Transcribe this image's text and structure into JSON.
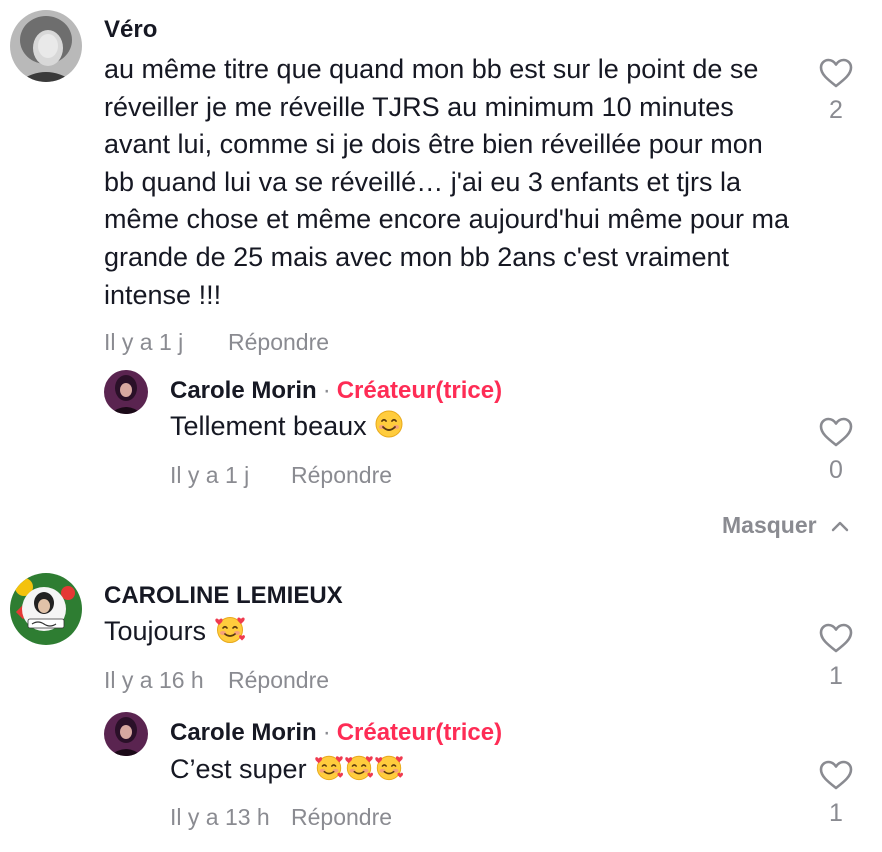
{
  "comments": [
    {
      "username": "Véro",
      "text": "au même titre que quand mon bb est sur le point de se réveiller je me réveille TJRS au minimum 10 minutes avant lui, comme si je dois être bien réveillée pour mon bb quand lui va se réveillé… j'ai eu 3 enfants et tjrs la même chose et même encore aujourd'hui même pour ma grande de 25 mais avec mon bb 2ans c'est vraiment intense !!!",
      "time": "Il y a 1 j",
      "reply_label": "Répondre",
      "likes": "2",
      "avatar_icon": "user-avatar",
      "replies": [
        {
          "username": "Carole Morin",
          "separator": "·",
          "badge": "Créateur(trice)",
          "text": "Tellement beaux",
          "emoji": "smiling-face-emoji",
          "time": "Il y a 1 j",
          "reply_label": "Répondre",
          "likes": "0"
        }
      ],
      "hide_label": "Masquer"
    },
    {
      "username": "CAROLINE LEMIEUX",
      "text": "Toujours",
      "emoji": "smiling-face-with-hearts-emoji",
      "time": "Il y a 16 h",
      "reply_label": "Répondre",
      "likes": "1",
      "replies": [
        {
          "username": "Carole Morin",
          "separator": "·",
          "badge": "Créateur(trice)",
          "text": "C’est super",
          "emoji": "smiling-face-with-hearts-emoji",
          "time": "Il y a 13 h",
          "reply_label": "Répondre",
          "likes": "1"
        }
      ]
    }
  ],
  "colors": {
    "accent": "#fe2c55",
    "muted": "#8a8b91",
    "text": "#161823"
  }
}
